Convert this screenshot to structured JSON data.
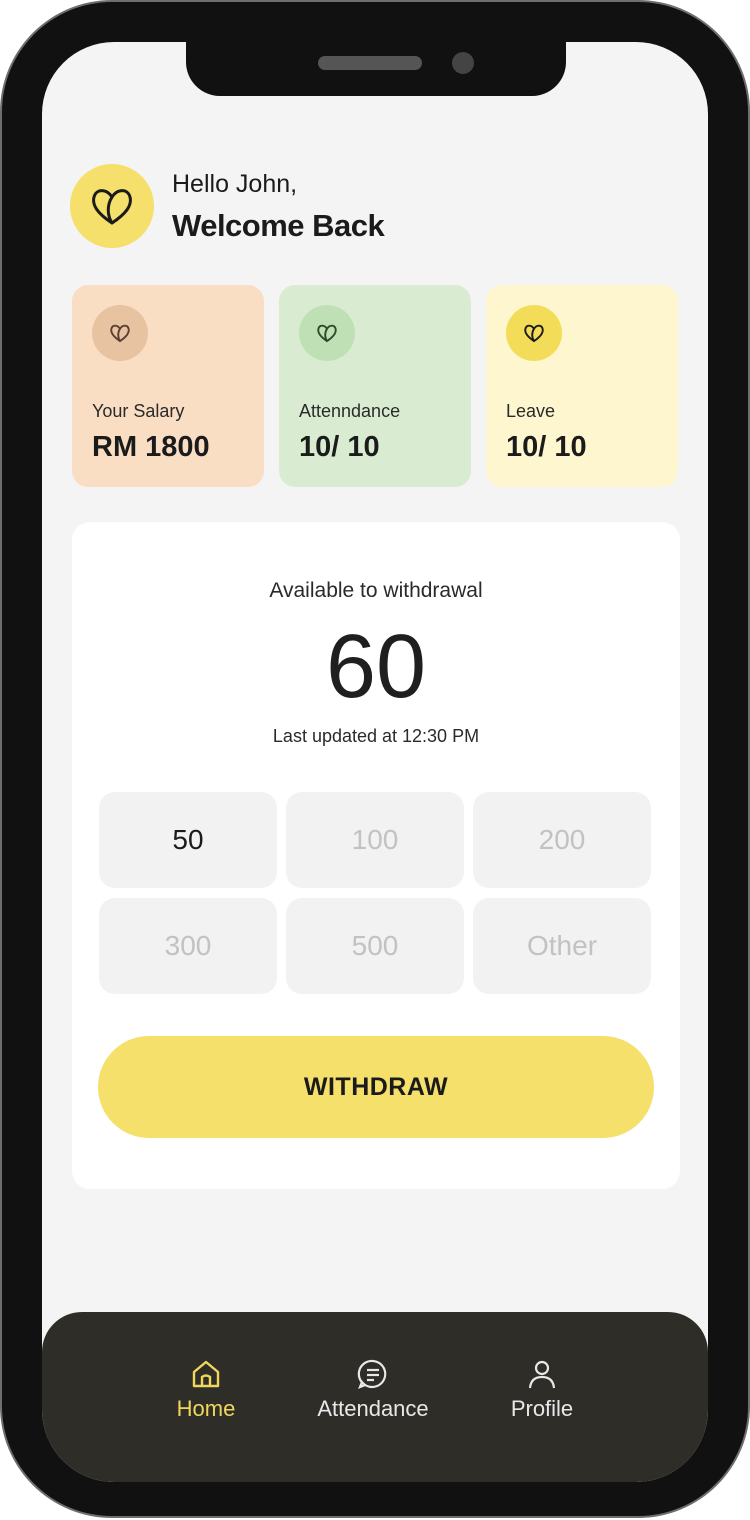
{
  "header": {
    "greeting": "Hello John,",
    "welcome": "Welcome Back",
    "logo_icon": "heart-logo-icon",
    "accent_color": "#f5e06b"
  },
  "stats": [
    {
      "label": "Your Salary",
      "value": "RM 1800",
      "icon": "heart-icon",
      "color": "#f9dec4"
    },
    {
      "label": "Attenndance",
      "value": "10/ 10",
      "icon": "heart-icon",
      "color": "#d9ecd2"
    },
    {
      "label": "Leave",
      "value": "10/ 10",
      "icon": "heart-icon",
      "color": "#fdf6cf"
    }
  ],
  "withdraw": {
    "title": "Available to withdrawal",
    "amount": "60",
    "updated": "Last updated at 12:30 PM",
    "options": [
      "50",
      "100",
      "200",
      "300",
      "500",
      "Other"
    ],
    "selected": "50",
    "button_label": "WITHDRAW"
  },
  "nav": {
    "items": [
      {
        "label": "Home",
        "icon": "home-icon",
        "active": true
      },
      {
        "label": "Attendance",
        "icon": "message-icon",
        "active": false
      },
      {
        "label": "Profile",
        "icon": "user-icon",
        "active": false
      }
    ],
    "background": "#2f2d28",
    "active_color": "#f0d75c"
  }
}
